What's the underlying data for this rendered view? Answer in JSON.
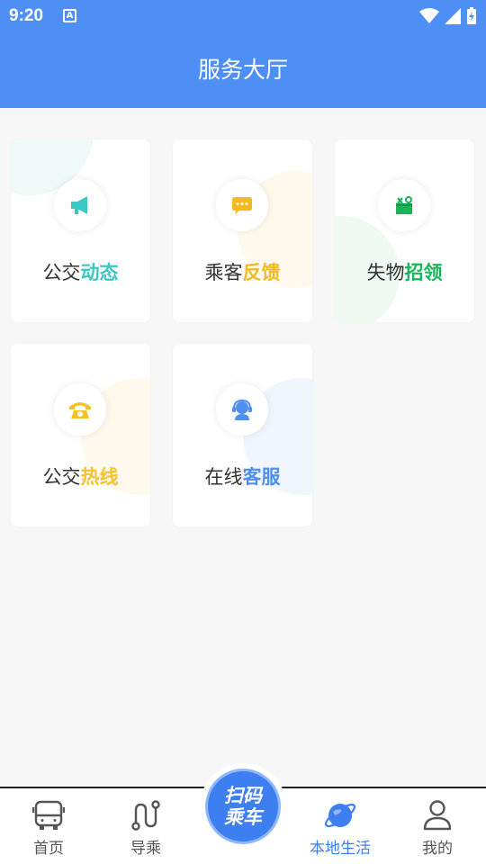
{
  "status_bar": {
    "time": "9:20",
    "notification_glyph": "A"
  },
  "header": {
    "title": "服务大厅"
  },
  "cards": [
    {
      "label_plain": "公交",
      "label_highlight": "动态",
      "accent": "#3cc8c2",
      "icon": "megaphone-icon"
    },
    {
      "label_plain": "乘客",
      "label_highlight": "反馈",
      "accent": "#f5b820",
      "icon": "chat-bubble-icon"
    },
    {
      "label_plain": "失物",
      "label_highlight": "招领",
      "accent": "#19b35a",
      "icon": "lost-found-box-icon"
    },
    {
      "label_plain": "公交",
      "label_highlight": "热线",
      "accent": "#f5c22a",
      "icon": "telephone-icon"
    },
    {
      "label_plain": "在线",
      "label_highlight": "客服",
      "accent": "#4f8ff2",
      "icon": "customer-service-icon"
    }
  ],
  "bottom_nav": {
    "items": [
      {
        "label": "首页",
        "icon": "bus-icon"
      },
      {
        "label": "导乘",
        "icon": "route-icon"
      },
      {
        "label": "本地生活",
        "icon": "planet-icon",
        "active": true
      },
      {
        "label": "我的",
        "icon": "user-icon"
      }
    ],
    "scan_button": {
      "line1": "扫码",
      "line2": "乘车"
    }
  },
  "colors": {
    "primary": "#4e8ff6",
    "active_nav": "#3d7ff0",
    "background": "#f7f7f7"
  }
}
